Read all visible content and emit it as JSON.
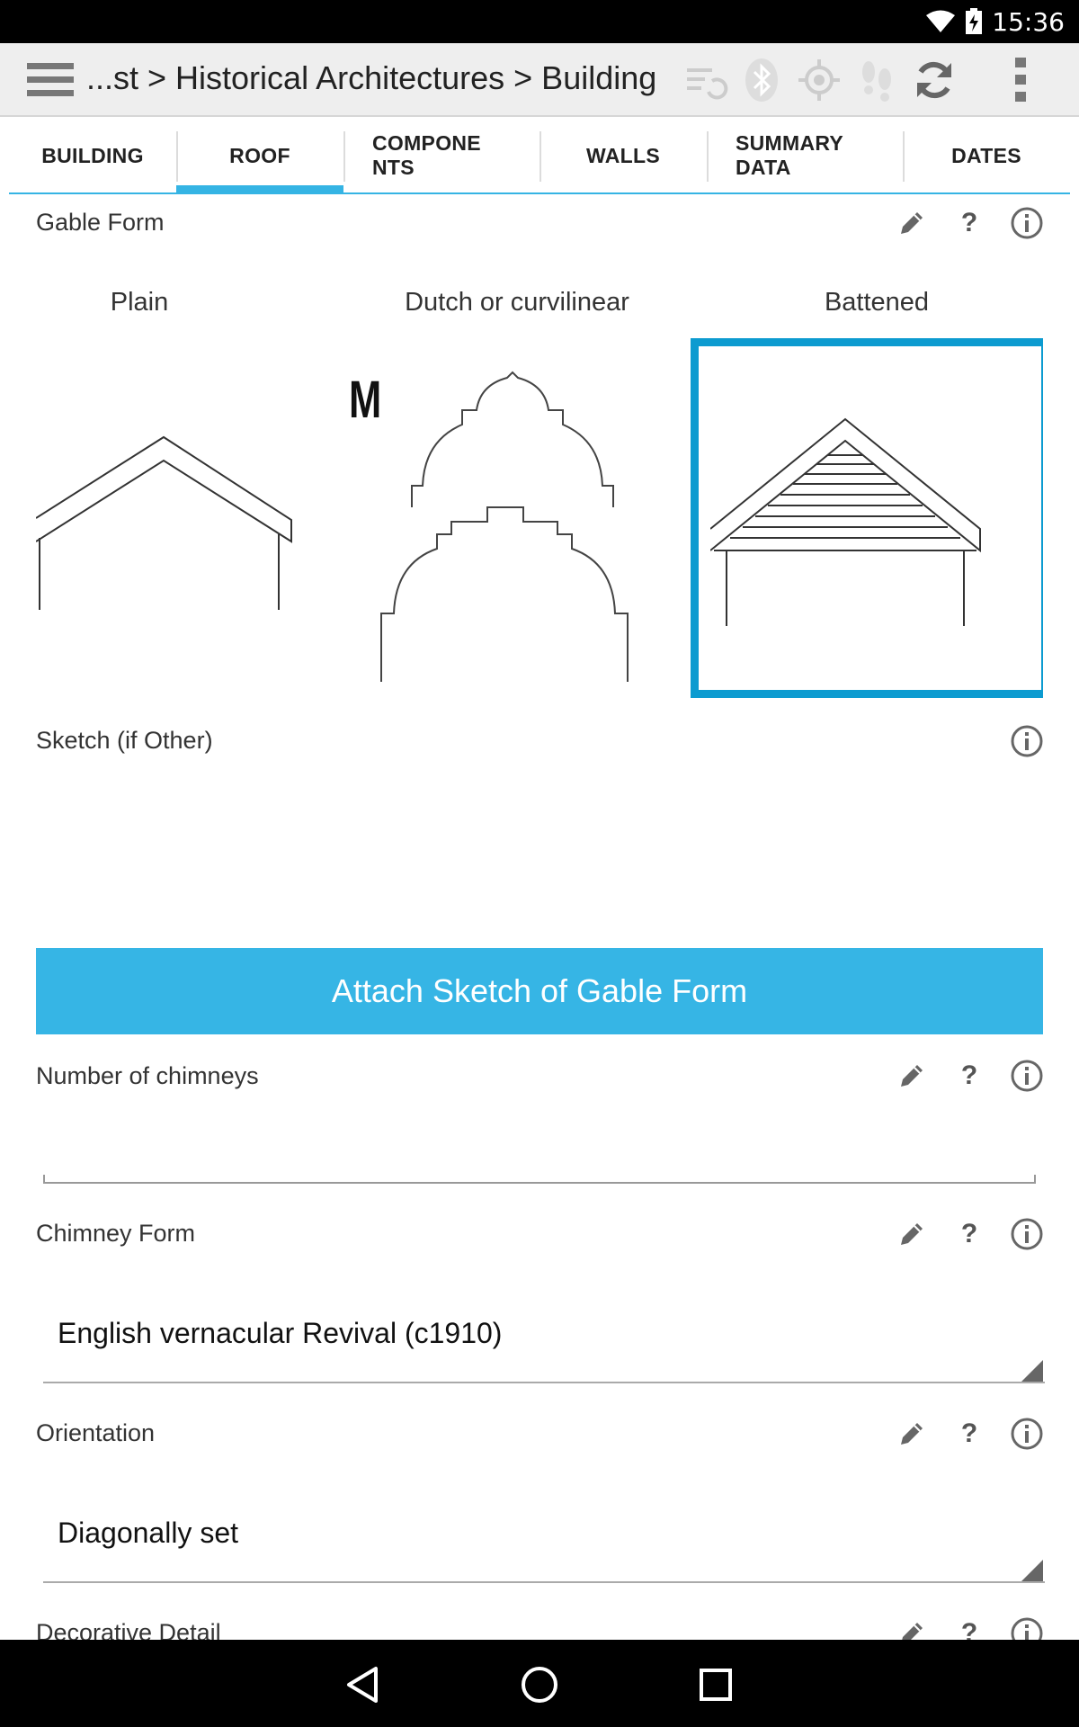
{
  "status": {
    "time": "15:36"
  },
  "toolbar": {
    "breadcrumb": "...st > Historical Architectures > Building"
  },
  "tabs": [
    {
      "label": "BUILDING"
    },
    {
      "label": "ROOF",
      "active": true
    },
    {
      "label": "COMPONE NTS"
    },
    {
      "label": "WALLS"
    },
    {
      "label": "SUMMARY DATA"
    },
    {
      "label": "DATES"
    }
  ],
  "gable_form": {
    "label": "Gable Form",
    "options": [
      {
        "label": "Plain"
      },
      {
        "label": "Dutch or curvilinear"
      },
      {
        "label": "Battened",
        "selected": true
      }
    ]
  },
  "sketch": {
    "label": "Sketch (if Other)"
  },
  "attach_button": {
    "label": "Attach Sketch of Gable Form"
  },
  "chimneys": {
    "label": "Number of chimneys",
    "value": ""
  },
  "chimney_form": {
    "label": "Chimney Form",
    "value": "English vernacular Revival (c1910)"
  },
  "orientation": {
    "label": "Orientation",
    "value": "Diagonally set"
  },
  "decorative": {
    "label": "Decorative Detail"
  },
  "colors": {
    "accent": "#36b5e5",
    "selected_border": "#0c9bd0"
  }
}
